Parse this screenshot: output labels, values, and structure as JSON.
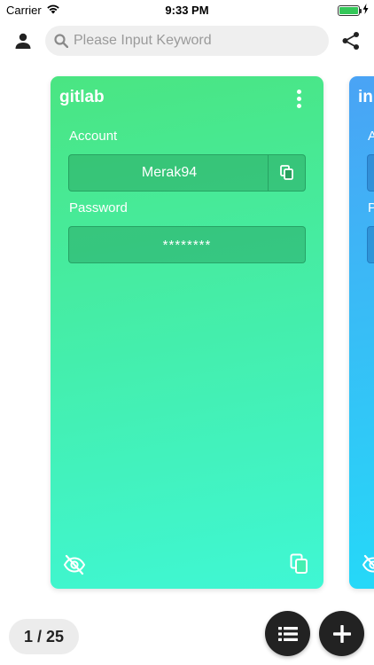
{
  "status_bar": {
    "carrier": "Carrier",
    "time": "9:33 PM",
    "battery_level": 1.0,
    "icons": [
      "wifi-icon",
      "battery-icon",
      "charging-bolt-icon"
    ]
  },
  "top_bar": {
    "search_placeholder": "Please Input Keyword",
    "icons": [
      "person-icon",
      "search-icon",
      "share-icon"
    ]
  },
  "cards": [
    {
      "title": "gitlab",
      "account_label": "Account",
      "account_value": "Merak94",
      "password_label": "Password",
      "password_value": "********",
      "color_top": "#4ae582",
      "color_bottom": "#3ff7d4"
    },
    {
      "title": "in",
      "account_label": "A",
      "password_label": "P",
      "color_top": "#4aa3f5",
      "color_bottom": "#22ddf8"
    }
  ],
  "pager": {
    "label": "1 / 25"
  },
  "fabs": {
    "list_icon": "list-icon",
    "add_icon": "plus-icon",
    "color": "#222222"
  }
}
